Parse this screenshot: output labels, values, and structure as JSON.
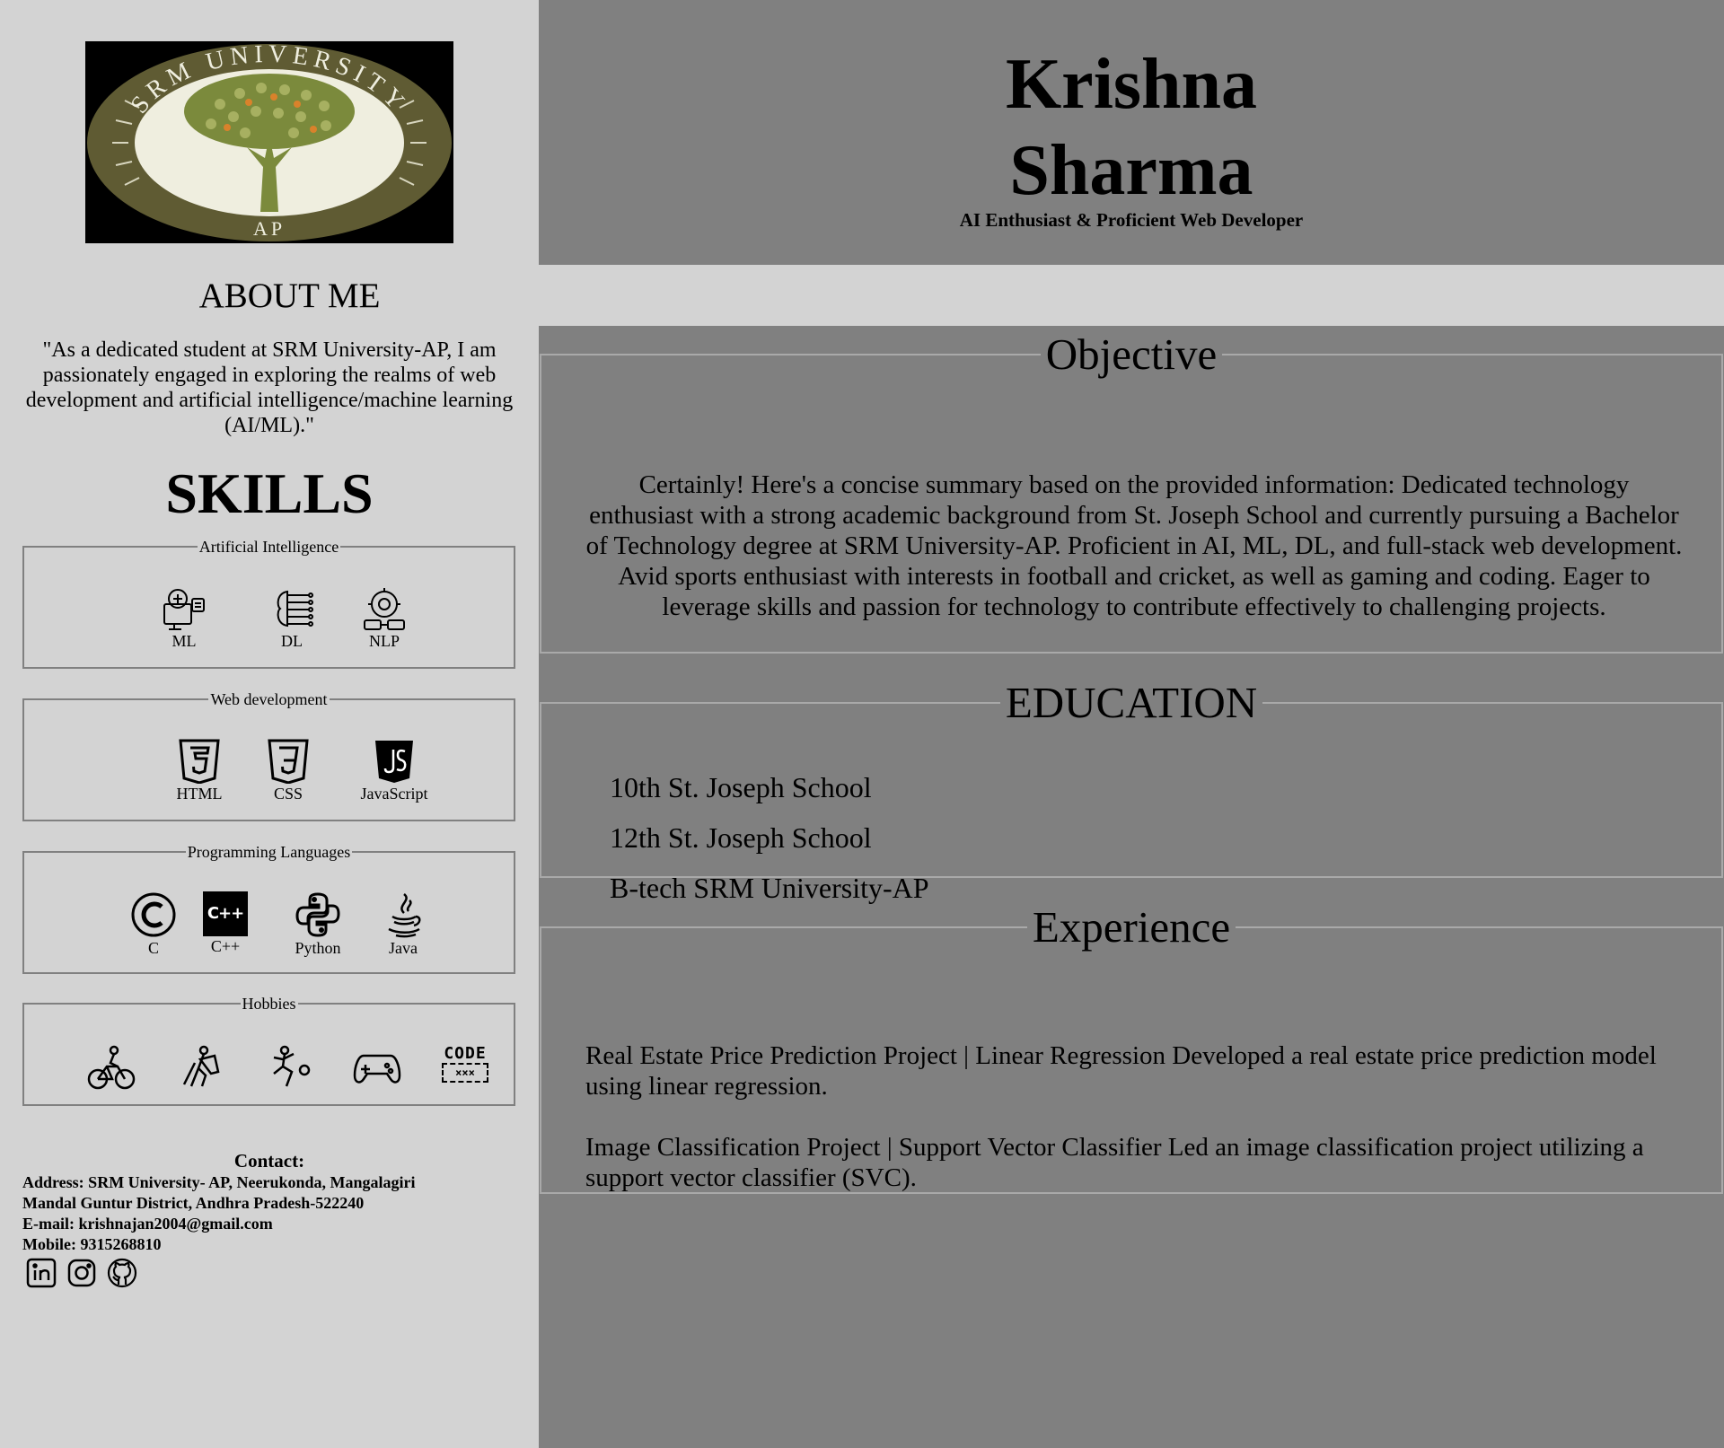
{
  "sidebar": {
    "logo": {
      "top_text": "SRM UNIVERSITY",
      "bottom_text": "AP",
      "colors": {
        "ring": "#5f5b33",
        "inner": "#efeedf",
        "tree": "#7b8a3c",
        "accent": "#d9822b"
      }
    },
    "about_title": "ABOUT ME",
    "about_text": "\"As a dedicated student at SRM University-AP, I am passionately engaged in exploring the realms of web development and artificial intelligence/machine learning (AI/ML).\"",
    "skills_title": "SKILLS",
    "skill_groups": [
      {
        "legend": "Artificial Intelligence",
        "items": [
          {
            "label": "ML",
            "icon": "ml-icon"
          },
          {
            "label": "DL",
            "icon": "dl-icon"
          },
          {
            "label": "NLP",
            "icon": "nlp-icon"
          }
        ]
      },
      {
        "legend": "Web development",
        "items": [
          {
            "label": "HTML",
            "icon": "html5-icon"
          },
          {
            "label": "CSS",
            "icon": "css3-icon"
          },
          {
            "label": "JavaScript",
            "icon": "javascript-icon"
          }
        ]
      },
      {
        "legend": "Programming Languages",
        "items": [
          {
            "label": "C",
            "icon": "c-language-icon"
          },
          {
            "label": "C++",
            "icon": "cpp-icon",
            "icon_text": "C++"
          },
          {
            "label": "Python",
            "icon": "python-icon"
          },
          {
            "label": "Java",
            "icon": "java-icon"
          }
        ]
      },
      {
        "legend": "Hobbies",
        "items": [
          {
            "icon": "cycling-icon"
          },
          {
            "icon": "cricket-icon"
          },
          {
            "icon": "football-icon"
          },
          {
            "icon": "gamepad-icon"
          },
          {
            "icon": "code-icon",
            "icon_text": "CODE"
          }
        ]
      }
    ],
    "contact": {
      "title": "Contact:",
      "address_line1": "Address: SRM University- AP, Neerukonda, Mangalagiri",
      "address_line2": "Mandal Guntur District, Andhra Pradesh-522240",
      "email": "E-mail: krishnajan2004@gmail.com",
      "mobile": "Mobile: 9315268810",
      "social_icons": [
        "linkedin-icon",
        "instagram-icon",
        "github-icon"
      ]
    }
  },
  "header": {
    "name_line1": "Krishna",
    "name_line2": "Sharma",
    "tagline": "AI Enthusiast & Proficient Web Developer"
  },
  "objective": {
    "title": "Objective",
    "text": "Certainly! Here's a concise summary based on the provided information: Dedicated technology enthusiast with a strong academic background from St. Joseph School and currently pursuing a Bachelor of Technology degree at SRM University-AP. Proficient in AI, ML, DL, and full-stack web development. Avid sports enthusiast with interests in football and cricket, as well as gaming and coding. Eager to leverage skills and passion for technology to contribute effectively to challenging projects."
  },
  "education": {
    "title": "EDUCATION",
    "items": [
      "10th St. Joseph School",
      "12th St. Joseph School",
      "B-tech SRM University-AP"
    ]
  },
  "experience": {
    "title": "Experience",
    "items": [
      "Real Estate Price Prediction Project | Linear Regression Developed a real estate price prediction model using linear regression.",
      "Image Classification Project | Support Vector Classifier Led an image classification project utilizing a support vector classifier (SVC)."
    ]
  },
  "colors": {
    "sidebar_bg": "#d3d3d3",
    "main_bg": "#808080",
    "text": "#000000"
  }
}
